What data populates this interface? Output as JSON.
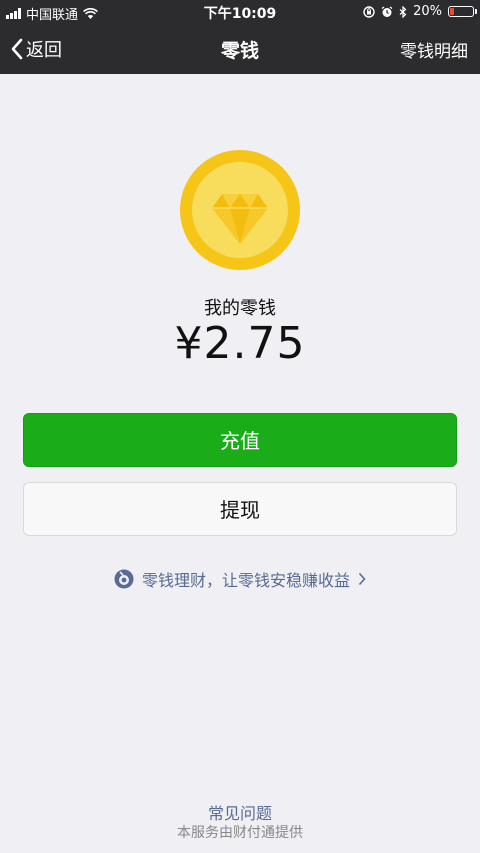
{
  "status_bar": {
    "carrier": "中国联通",
    "time": "下午10:09",
    "battery_percent": "20%",
    "battery_level": 0.2,
    "icons": [
      "signal-icon",
      "wifi-icon",
      "rotation-lock-icon",
      "alarm-icon",
      "bluetooth-icon",
      "battery-icon"
    ]
  },
  "nav": {
    "back_label": "返回",
    "title": "零钱",
    "detail_label": "零钱明细"
  },
  "balance": {
    "icon": "diamond-coin-icon",
    "label": "我的零钱",
    "amount": "¥2.75"
  },
  "actions": {
    "recharge_label": "充值",
    "withdraw_label": "提现"
  },
  "promo": {
    "icon": "licaitong-icon",
    "text": "零钱理财，让零钱安稳赚收益"
  },
  "footer": {
    "faq_label": "常见问题",
    "provider_text": "本服务由财付通提供"
  },
  "colors": {
    "nav_background": "#2c2c2e",
    "page_background": "#efeff4",
    "primary_green": "#1aad19",
    "link_blue": "#576b95",
    "coin_gold": "#f5c518",
    "battery_red": "#e94b3c"
  }
}
